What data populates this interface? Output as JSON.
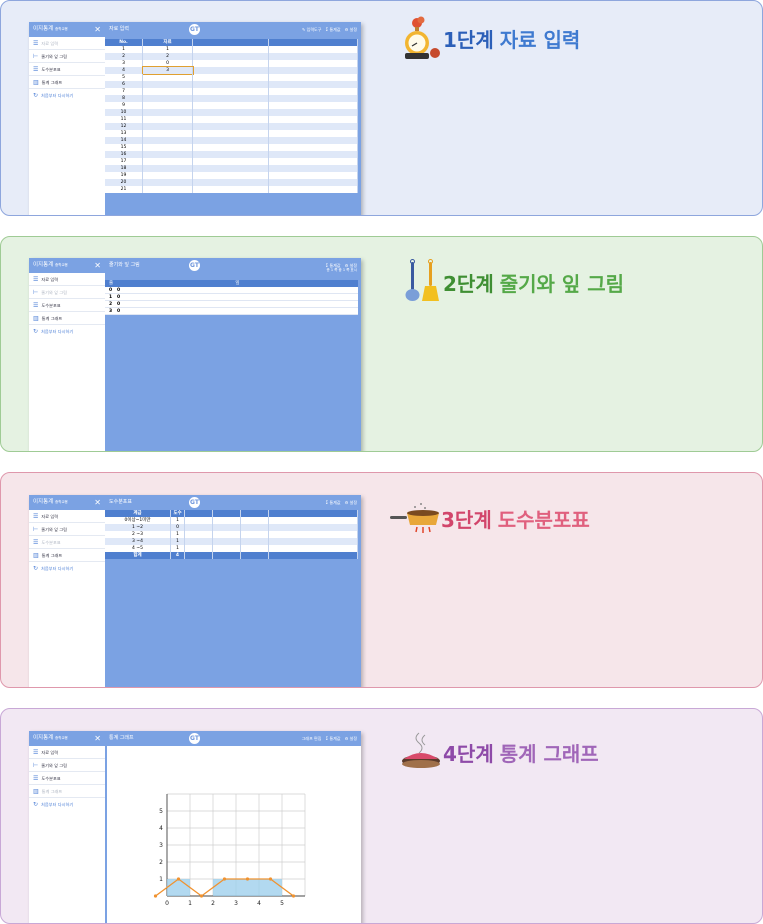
{
  "colors": {
    "step1": "#2c5fb8",
    "step2": "#3f8f33",
    "step3": "#d2456b",
    "step4": "#8e4aa8",
    "app_blue": "#7ba2e3",
    "header_blue": "#4f7fcf"
  },
  "side": {
    "app_title": "이지통계",
    "app_sub": "중학교용",
    "items": [
      {
        "icon": "list-icon",
        "label": "자료 입력"
      },
      {
        "icon": "stem-leaf-icon",
        "label": "줄기와 잎 그림"
      },
      {
        "icon": "table-icon",
        "label": "도수분포표"
      },
      {
        "icon": "bar-chart-icon",
        "label": "통계 그래프"
      }
    ],
    "restart": "처음부터 다시하기"
  },
  "steps": [
    {
      "num": "1단계",
      "title": "자료 입력",
      "screen_title": "자료 입력",
      "tools": [
        "✎ 입력도구",
        "Σ 통계값",
        "⚙ 설정"
      ]
    },
    {
      "num": "2단계",
      "title": "줄기와 잎 그림",
      "screen_title": "줄기와 잎 그림",
      "tools": [
        "Σ 통계값",
        "⚙ 설정"
      ],
      "page_info": "총 1 쪽 중 1 쪽 표시"
    },
    {
      "num": "3단계",
      "title": "도수분포표",
      "screen_title": "도수분포표",
      "tools": [
        "Σ 통계값",
        "⚙ 설정"
      ]
    },
    {
      "num": "4단계",
      "title": "통계 그래프",
      "screen_title": "통계 그래프",
      "tools": [
        "그래프 편집",
        "Σ 통계값",
        "⚙ 설정"
      ]
    }
  ],
  "input_table": {
    "headers": [
      "No.",
      "자료"
    ],
    "rows": [
      [
        "1",
        "1"
      ],
      [
        "2",
        "2"
      ],
      [
        "3",
        "0"
      ],
      [
        "4",
        "3"
      ],
      [
        "5",
        ""
      ],
      [
        "6",
        ""
      ],
      [
        "7",
        ""
      ],
      [
        "8",
        ""
      ],
      [
        "9",
        ""
      ],
      [
        "10",
        ""
      ],
      [
        "11",
        ""
      ],
      [
        "12",
        ""
      ],
      [
        "13",
        ""
      ],
      [
        "14",
        ""
      ],
      [
        "15",
        ""
      ],
      [
        "16",
        ""
      ],
      [
        "17",
        ""
      ],
      [
        "18",
        ""
      ],
      [
        "19",
        ""
      ],
      [
        "20",
        ""
      ],
      [
        "21",
        ""
      ]
    ]
  },
  "stem_leaf": {
    "headers": [
      "줄기",
      "잎"
    ],
    "rows": [
      [
        "0",
        "0"
      ],
      [
        "1",
        "0"
      ],
      [
        "2",
        "0"
      ],
      [
        "3",
        "0"
      ]
    ]
  },
  "freq_table": {
    "headers": [
      "계급",
      "도수"
    ],
    "rows": [
      [
        "0이상~1미만",
        "1"
      ],
      [
        "1 ~2",
        "0"
      ],
      [
        "2 ~3",
        "1"
      ],
      [
        "3 ~4",
        "1"
      ],
      [
        "4 ~5",
        "1"
      ]
    ],
    "total_label": "합계",
    "total": "4"
  },
  "chart_data": {
    "type": "area",
    "categories": [
      "0",
      "1",
      "2",
      "3",
      "4",
      "5"
    ],
    "x": [
      -0.5,
      0.5,
      1.5,
      2.5,
      3.5,
      4.5,
      5.5
    ],
    "values": [
      0,
      1,
      0,
      1,
      1,
      1,
      0
    ],
    "xticks": [
      "0",
      "1",
      "2",
      "3",
      "4",
      "5"
    ],
    "yticks": [
      "1",
      "2",
      "3",
      "4",
      "5"
    ],
    "xlim": [
      0,
      6
    ],
    "ylim": [
      0,
      6
    ],
    "grid": true,
    "line_color": "#f0922f",
    "fill_color": "#9fd0ec"
  }
}
